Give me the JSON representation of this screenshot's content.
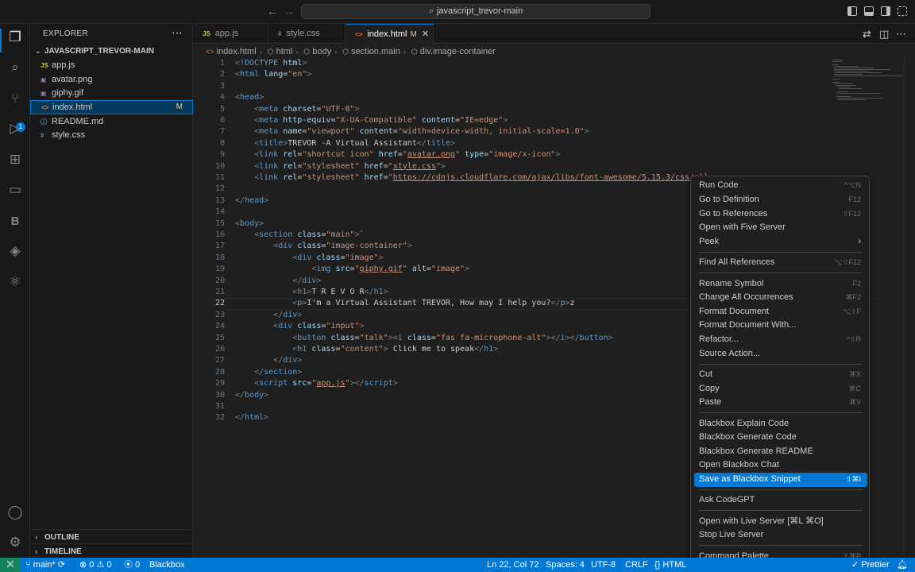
{
  "titlebar": {
    "back_icon": "arrow-left-icon",
    "forward_icon": "arrow-right-icon",
    "search_text": "javascript_trevor-main"
  },
  "explorer": {
    "title": "EXPLORER",
    "folder": "JAVASCRIPT_TREVOR-MAIN",
    "files": [
      {
        "name": "app.js",
        "icon": "JS",
        "status": ""
      },
      {
        "name": "avatar.png",
        "icon": "▣",
        "status": ""
      },
      {
        "name": "giphy.gif",
        "icon": "▣",
        "status": ""
      },
      {
        "name": "index.html",
        "icon": "<>",
        "status": "M"
      },
      {
        "name": "README.md",
        "icon": "ⓘ",
        "status": ""
      },
      {
        "name": "style.css",
        "icon": "#",
        "status": ""
      }
    ],
    "outline": "OUTLINE",
    "timeline": "TIMELINE"
  },
  "activity": {
    "source_control_badge": "1"
  },
  "tabs": [
    {
      "label": "app.js",
      "icon": "JS",
      "modified": ""
    },
    {
      "label": "style.css",
      "icon": "#",
      "modified": ""
    },
    {
      "label": "index.html",
      "icon": "<>",
      "modified": "M"
    }
  ],
  "breadcrumb": [
    "index.html",
    "html",
    "body",
    "section.main",
    "div.image-container"
  ],
  "editor": {
    "current_line": 22,
    "line_numbers": [
      "1",
      "2",
      "3",
      "4",
      "5",
      "6",
      "7",
      "8",
      "9",
      "10",
      "11",
      "12",
      "13",
      "14",
      "15",
      "16",
      "17",
      "18",
      "19",
      "20",
      "21",
      "22",
      "23",
      "24",
      "25",
      "26",
      "27",
      "28",
      "29",
      "30",
      "31",
      "32"
    ]
  },
  "context_menu": {
    "items": [
      {
        "label": "Run Code",
        "kb": "^⌥N"
      },
      {
        "label": "Go to Definition",
        "kb": "F12"
      },
      {
        "label": "Go to References",
        "kb": "⇧F12"
      },
      {
        "label": "Open with Five Server",
        "kb": ""
      },
      {
        "label": "Peek",
        "kb": "",
        "submenu": "›"
      },
      {
        "label": "Find All References",
        "kb": "⌥⇧F12"
      },
      {
        "label": "Rename Symbol",
        "kb": "F2"
      },
      {
        "label": "Change All Occurrences",
        "kb": "⌘F2"
      },
      {
        "label": "Format Document",
        "kb": "⌥⇧F"
      },
      {
        "label": "Format Document With...",
        "kb": ""
      },
      {
        "label": "Refactor...",
        "kb": "^⇧R"
      },
      {
        "label": "Source Action...",
        "kb": ""
      },
      {
        "label": "Cut",
        "kb": "⌘X"
      },
      {
        "label": "Copy",
        "kb": "⌘C"
      },
      {
        "label": "Paste",
        "kb": "⌘V"
      },
      {
        "label": "Blackbox Explain Code",
        "kb": ""
      },
      {
        "label": "Blackbox Generate Code",
        "kb": ""
      },
      {
        "label": "Blackbox Generate README",
        "kb": ""
      },
      {
        "label": "Open Blackbox Chat",
        "kb": ""
      },
      {
        "label": "Save as Blackbox Snippet",
        "kb": "⇧⌘I"
      },
      {
        "label": "Ask CodeGPT",
        "kb": ""
      },
      {
        "label": "Open with Live Server [⌘L ⌘O]",
        "kb": ""
      },
      {
        "label": "Stop Live Server",
        "kb": ""
      },
      {
        "label": "Command Palette...",
        "kb": "⇧⌘P"
      }
    ],
    "highlighted": "Save as Blackbox Snippet"
  },
  "statusbar": {
    "branch": "main*",
    "errors": "0",
    "warnings": "0",
    "ports": "0",
    "blackbox": "Blackbox",
    "position": "Ln 22, Col 72",
    "spaces": "Spaces: 4",
    "encoding": "UTF-8",
    "eol": "CRLF",
    "language": "HTML",
    "prettier": "Prettier"
  },
  "colors": {
    "accent": "#0078d4",
    "statusbar": "#0078d4",
    "background": "#1f1f1f"
  }
}
